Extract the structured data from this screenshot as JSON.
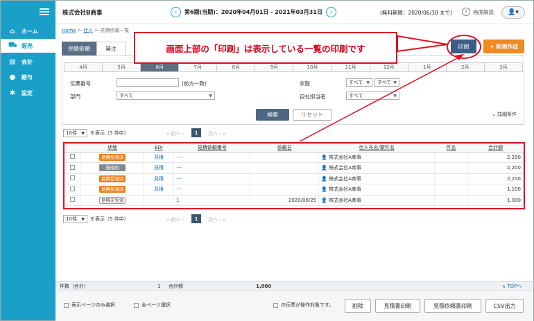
{
  "header": {
    "company": "株式会社B商事",
    "period": "第6期(当期)：2020年04月01日 - 2021年03月31日",
    "trial": "(無料期限：2020/06/30 まで)",
    "help": "画面解説"
  },
  "sidebar": {
    "items": [
      {
        "label": "ホーム",
        "icon": "home-icon"
      },
      {
        "label": "販売",
        "icon": "cart-icon"
      },
      {
        "label": "会計",
        "icon": "ledger-icon"
      },
      {
        "label": "給与",
        "icon": "money-bag-icon"
      },
      {
        "label": "設定",
        "icon": "gear-icon"
      }
    ]
  },
  "breadcrumb": {
    "home": "Home",
    "sep": ">",
    "section": "仕入",
    "current": "見積依頼一覧"
  },
  "tabs": {
    "estimate": "見積依頼",
    "order": "発注"
  },
  "toolbar": {
    "print": "印刷",
    "new": "+ 新規作成"
  },
  "callout": "画面上部の「印刷」は表示している一覧の印刷です",
  "months": [
    "4月",
    "5月",
    "6月",
    "7月",
    "8月",
    "9月",
    "10月",
    "11月",
    "12月",
    "1月",
    "2月",
    "3月"
  ],
  "search": {
    "slip_label": "伝票番号",
    "slip_hint": "(前方一致)",
    "dept_label": "部門",
    "dept_value": "すべて",
    "status_label": "状態",
    "status_value1": "すべて",
    "status_value2": "すべて",
    "staff_label": "自社担当者",
    "staff_value": "すべて",
    "search_btn": "検索",
    "reset_btn": "リセット",
    "detail": "⌄ 詳細条件"
  },
  "pager": {
    "per_page": "10件",
    "display": "を表示（5 件中）",
    "display2": "を表示（5 件中）",
    "prev": "«  前へ  ‹",
    "page": "1",
    "next": "次へ ›  »"
  },
  "table": {
    "headers": [
      "状態",
      "EDI",
      "見積依頼番号",
      "依頼日",
      "仕入先名/案件名",
      "件名",
      "合計額"
    ],
    "rows": [
      {
        "status": "見積受領済",
        "status_kind": "orange",
        "edi": "見積",
        "number": "---",
        "date": "",
        "supplier": "株式会社A商事",
        "subject": "",
        "total": "2,200"
      },
      {
        "status": "過成約",
        "status_kind": "gray",
        "edi": "見積",
        "number": "---",
        "date": "",
        "supplier": "株式会社A商事",
        "subject": "",
        "total": "2,200"
      },
      {
        "status": "見積受領済",
        "status_kind": "orange",
        "edi": "見積",
        "number": "---",
        "date": "",
        "supplier": "株式会社A商事",
        "subject": "",
        "total": "2,200"
      },
      {
        "status": "見積受領済",
        "status_kind": "orange",
        "edi": "見積",
        "number": "---",
        "date": "",
        "supplier": "株式会社A商事",
        "subject": "",
        "total": "1,100"
      },
      {
        "status": "見積未受領",
        "status_kind": "white",
        "edi": "",
        "number": "1",
        "date": "2020/06/25",
        "supplier": "株式会社A商事",
        "subject": "",
        "total": "1,000"
      }
    ]
  },
  "summary": {
    "count_label": "件数（合計）",
    "count": "1",
    "total_label": "合計額",
    "total": "1,000",
    "top": "∧ TOPへ"
  },
  "footer": {
    "page_only": "表示ページのみ選択",
    "all_pages": "全ページ選択",
    "selected": "の伝票が操作対象です。",
    "delete": "削除",
    "print_estimate": "見積書印刷",
    "print_request": "見積依頼書印刷",
    "csv": "CSV出力"
  },
  "colors": {
    "sidebar": "#1aa0c8",
    "accent_red": "#e01020",
    "primary": "#3b5d86",
    "orange": "#ef8a1f"
  }
}
